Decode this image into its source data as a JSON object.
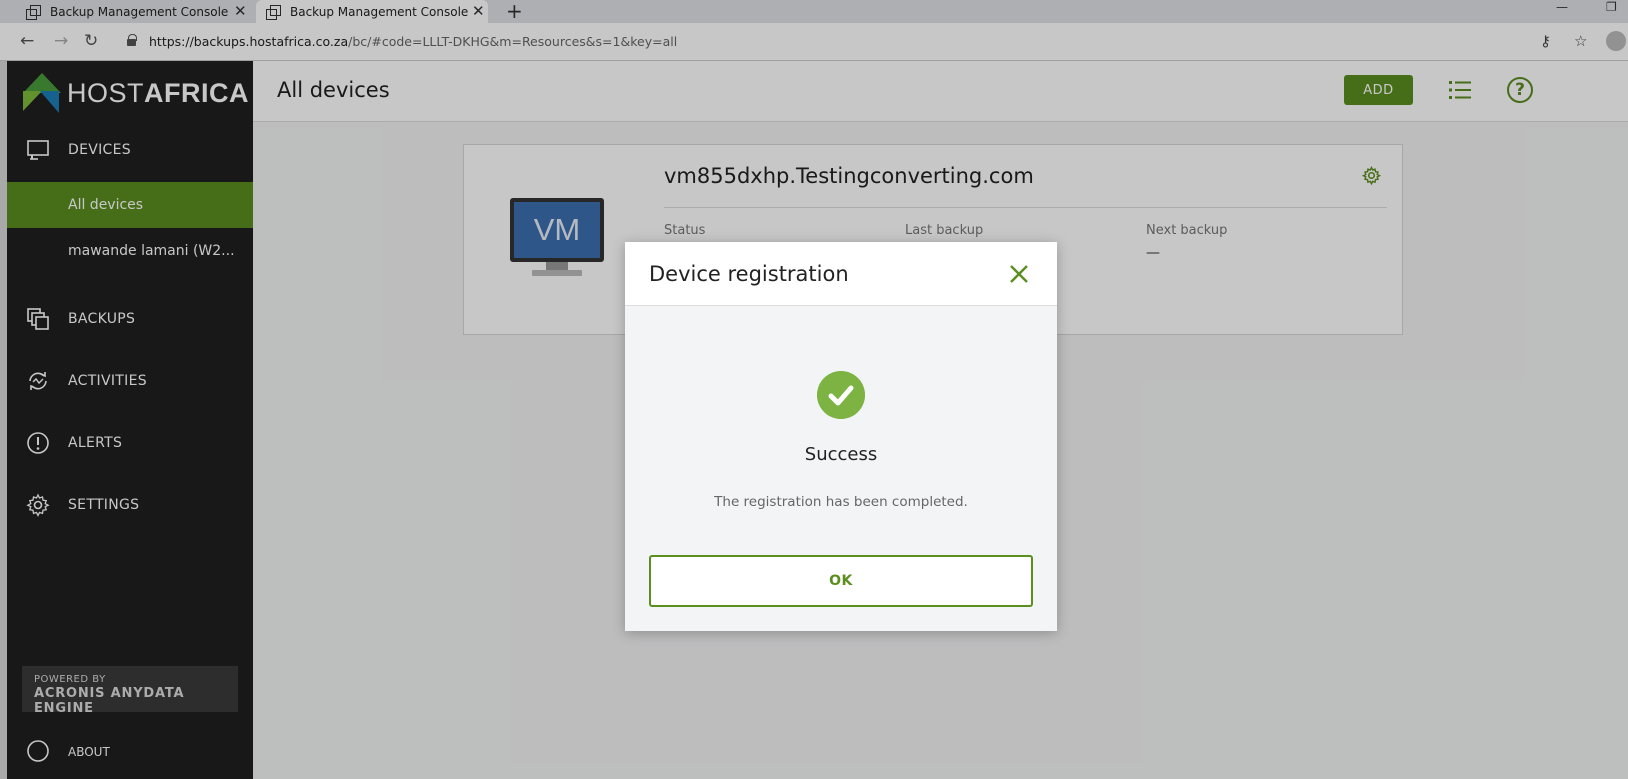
{
  "browser": {
    "tabs": [
      {
        "title": "Backup Management Console"
      },
      {
        "title": "Backup Management Console"
      }
    ],
    "url_host": "https://backups.hostafrica.co.za",
    "url_path": "/bc/#code=LLLT-DKHG&m=Resources&s=1&key=all"
  },
  "logo": {
    "part1": "HOST",
    "part2": "AFRICA"
  },
  "sidebar": {
    "devices": "DEVICES",
    "sub_items": [
      "All devices",
      "mawande lamani (W2..."
    ],
    "backups": "BACKUPS",
    "activities": "ACTIVITIES",
    "alerts": "ALERTS",
    "settings": "SETTINGS",
    "powered_by": "POWERED BY",
    "engine": "ACRONIS ANYDATA ENGINE",
    "about": "ABOUT"
  },
  "header": {
    "title": "All devices",
    "add_label": "ADD",
    "help_symbol": "?"
  },
  "device_card": {
    "vm_label": "VM",
    "name": "vm855dxhp.Testingconverting.com",
    "columns": [
      {
        "label": "Status",
        "value": ""
      },
      {
        "label": "Last backup",
        "value": ""
      },
      {
        "label": "Next backup",
        "value": "—"
      }
    ]
  },
  "modal": {
    "title": "Device registration",
    "status": "Success",
    "message": "The registration has been completed.",
    "ok_label": "OK"
  },
  "colors": {
    "brand_green": "#5a8e1f",
    "success_green": "#7cb342",
    "sidebar_bg": "#1f1f1f"
  }
}
